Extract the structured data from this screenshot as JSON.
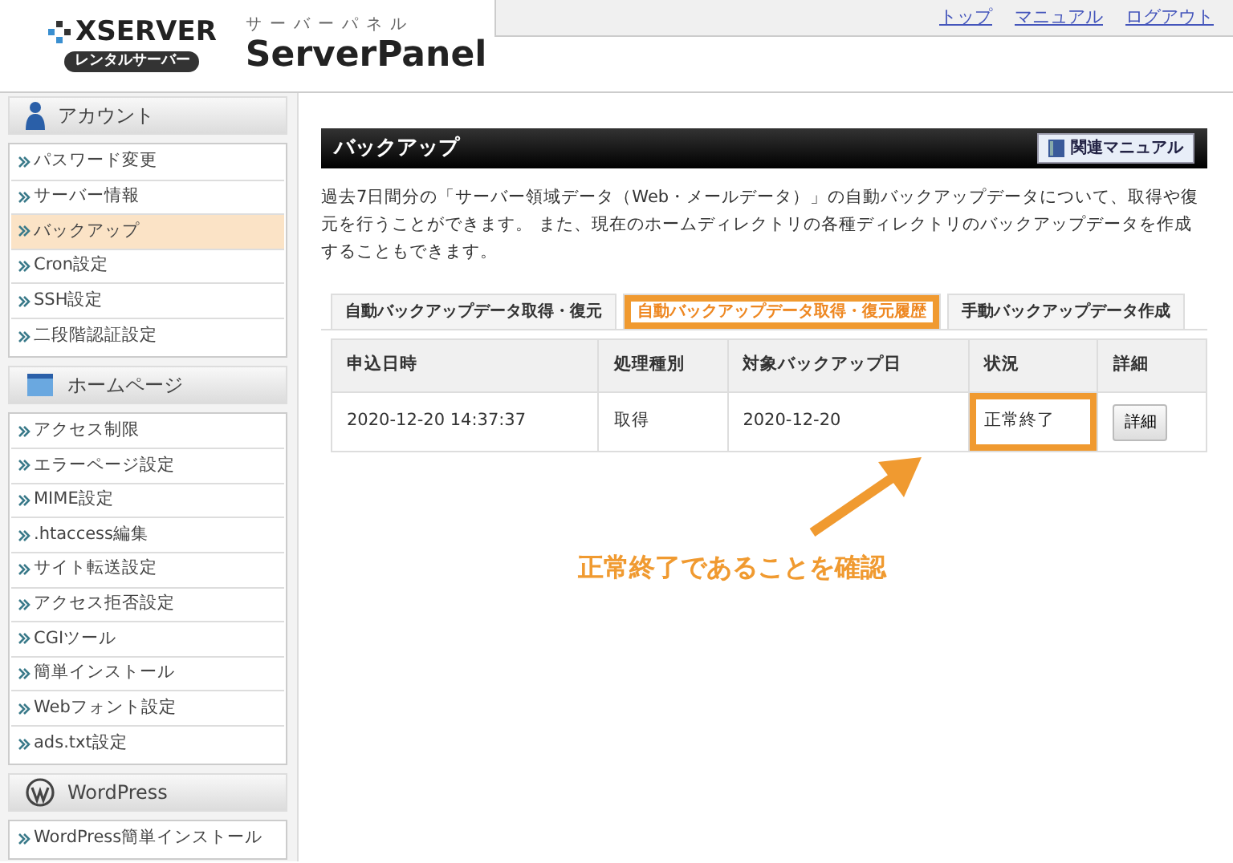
{
  "header": {
    "brand": "XSERVER",
    "brand_badge": "レンタルサーバー",
    "kana": "サーバーパネル",
    "product": "ServerPanel",
    "links": [
      "トップ",
      "マニュアル",
      "ログアウト"
    ]
  },
  "sidebar": [
    {
      "title": "アカウント",
      "items": [
        {
          "label": "パスワード変更",
          "selected": false
        },
        {
          "label": "サーバー情報",
          "selected": false
        },
        {
          "label": "バックアップ",
          "selected": true
        },
        {
          "label": "Cron設定",
          "selected": false
        },
        {
          "label": "SSH設定",
          "selected": false
        },
        {
          "label": "二段階認証設定",
          "selected": false
        }
      ]
    },
    {
      "title": "ホームページ",
      "items": [
        {
          "label": "アクセス制限",
          "selected": false
        },
        {
          "label": "エラーページ設定",
          "selected": false
        },
        {
          "label": "MIME設定",
          "selected": false
        },
        {
          "label": ".htaccess編集",
          "selected": false
        },
        {
          "label": "サイト転送設定",
          "selected": false
        },
        {
          "label": "アクセス拒否設定",
          "selected": false
        },
        {
          "label": "CGIツール",
          "selected": false
        },
        {
          "label": "簡単インストール",
          "selected": false
        },
        {
          "label": "Webフォント設定",
          "selected": false
        },
        {
          "label": "ads.txt設定",
          "selected": false
        }
      ]
    },
    {
      "title": "WordPress",
      "items": [
        {
          "label": "WordPress簡単インストール",
          "selected": false
        }
      ]
    }
  ],
  "main": {
    "title": "バックアップ",
    "manual_button": "関連マニュアル",
    "description": "過去7日間分の「サーバー領域データ（Web・メールデータ）」の自動バックアップデータについて、取得や復元を行うことができます。 また、現在のホームディレクトリの各種ディレクトリのバックアップデータを作成することもできます。",
    "tabs": [
      {
        "label": "自動バックアップデータ取得・復元",
        "selected": false,
        "highlighted": false
      },
      {
        "label": "自動バックアップデータ取得・復元履歴",
        "selected": true,
        "highlighted": true
      },
      {
        "label": "手動バックアップデータ作成",
        "selected": false,
        "highlighted": false
      }
    ],
    "table": {
      "columns": [
        "申込日時",
        "処理種別",
        "対象バックアップ日",
        "状況",
        "詳細"
      ],
      "rows": [
        {
          "cells": [
            {
              "text": "2020-12-20 14:37:37",
              "highlighted": false
            },
            {
              "text": "取得",
              "highlighted": false
            },
            {
              "text": "2020-12-20",
              "highlighted": false
            },
            {
              "text": "正常終了",
              "highlighted": true
            }
          ],
          "button": "詳細"
        }
      ]
    },
    "callout": "正常終了であることを確認"
  }
}
